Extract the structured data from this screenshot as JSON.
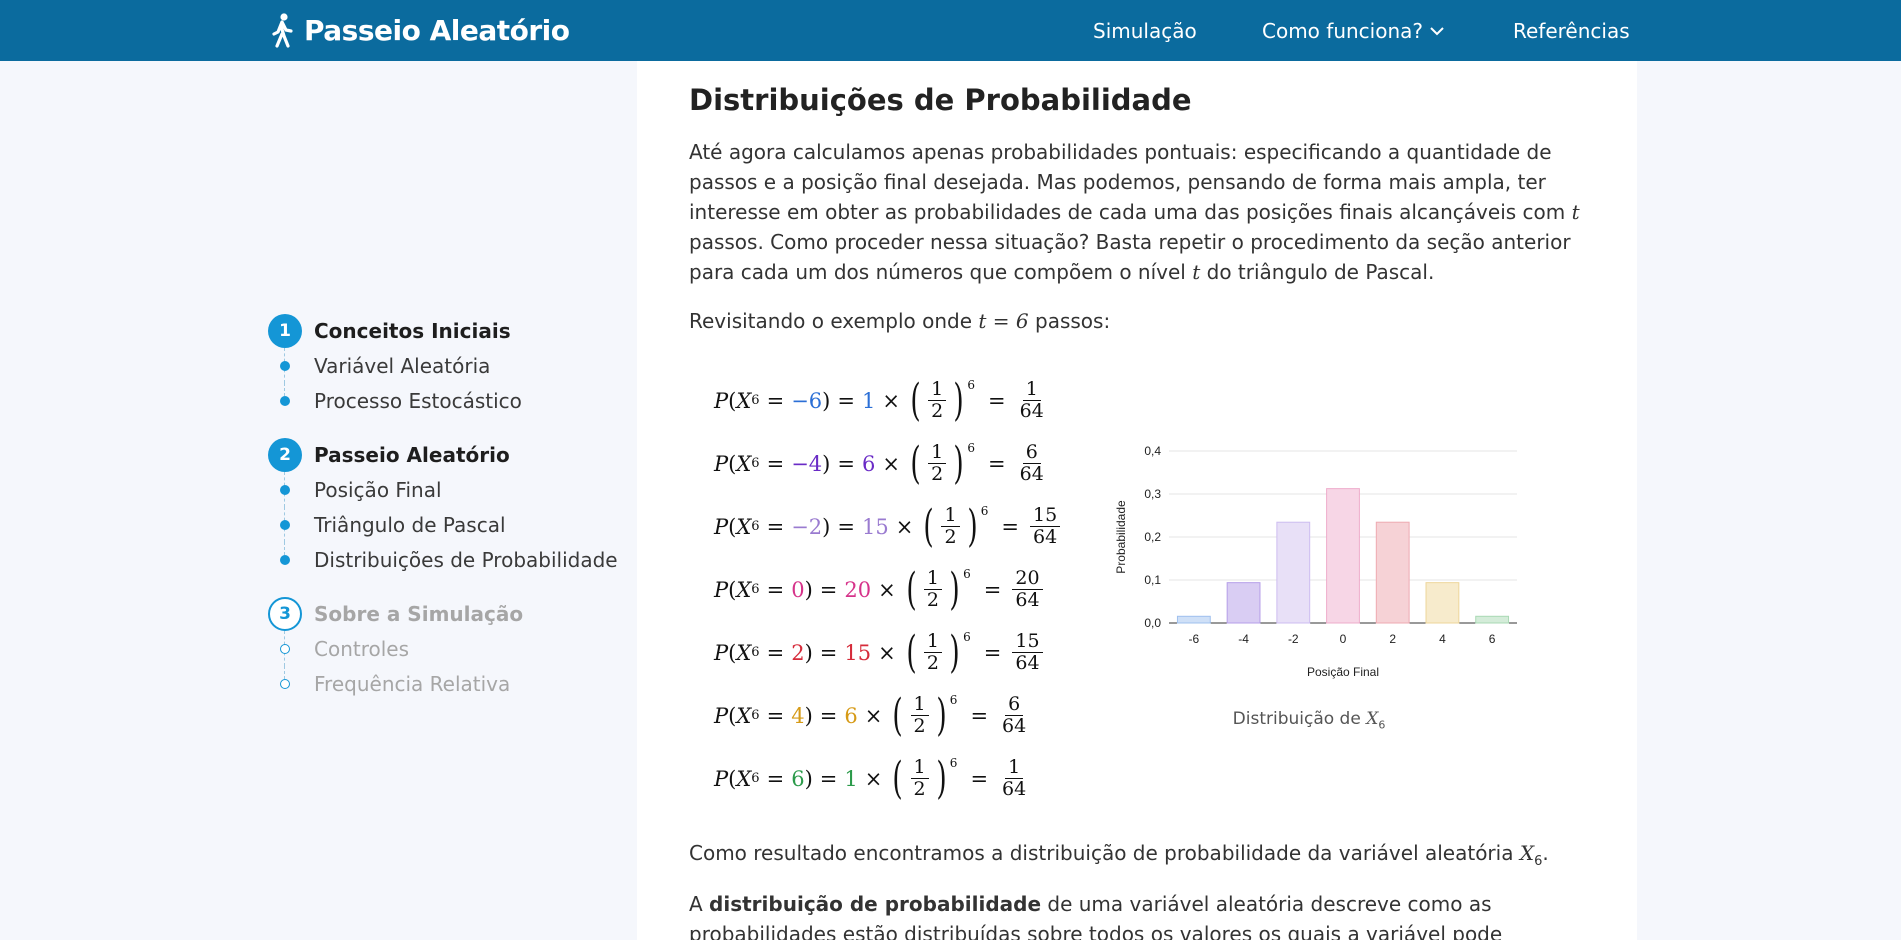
{
  "header": {
    "brand": "Passeio Aleatório",
    "nav": [
      {
        "label": "Simulação"
      },
      {
        "label": "Como funciona?"
      },
      {
        "label": "Referências"
      }
    ]
  },
  "sidebar": {
    "sections": [
      {
        "number": "1",
        "title": "Conceitos Iniciais",
        "items": [
          "Variável Aleatória",
          "Processo Estocástico"
        ]
      },
      {
        "number": "2",
        "title": "Passeio Aleatório",
        "items": [
          "Posição Final",
          "Triângulo de Pascal",
          "Distribuições de Probabilidade"
        ]
      },
      {
        "number": "3",
        "title": "Sobre a Simulação",
        "items": [
          "Controles",
          "Frequência Relativa"
        ]
      }
    ]
  },
  "main": {
    "title": "Distribuições de Probabilidade",
    "p1_a": "Até agora calculamos apenas probabilidades pontuais: especificando a quantidade de passos e a posição final desejada. Mas podemos, pensando de forma mais ampla, ter interesse em obter as probabilidades de cada uma das posições finais alcançáveis com ",
    "p1_t": "t",
    "p1_b": " passos. Como proceder nessa situação? Basta repetir o procedimento da seção anterior para cada um dos números que compõem o nível ",
    "p1_t2": "t",
    "p1_c": " do triângulo de Pascal.",
    "p2_a": "Revisitando o exemplo onde ",
    "p2_math": "t = 6",
    "p2_b": " passos:",
    "p3_a": "Como resultado encontramos a distribuição de probabilidade da variável aleatória ",
    "p3_var": "X",
    "p3_sub": "6",
    "p3_b": ".",
    "p4_a": "A ",
    "p4_bold": "distribuição de probabilidade",
    "p4_b": " de uma variável aleatória descreve como as probabilidades estão distribuídas sobre todos os valores os quais a variável pode assumir. No contexto de uma",
    "caption_a": "Distribuição de ",
    "caption_var": "X",
    "caption_sub": "6"
  },
  "equations": [
    {
      "pos": "−6",
      "coef": "1",
      "num": "1",
      "color": "#2b6fd6"
    },
    {
      "pos": "−4",
      "coef": "6",
      "num": "6",
      "color": "#6a2bc6"
    },
    {
      "pos": "−2",
      "coef": "15",
      "num": "15",
      "color": "#9a7bd0"
    },
    {
      "pos": "0",
      "coef": "20",
      "num": "20",
      "color": "#d6338a"
    },
    {
      "pos": "2",
      "coef": "15",
      "num": "15",
      "color": "#d62b3a"
    },
    {
      "pos": "4",
      "coef": "6",
      "num": "6",
      "color": "#d69a16"
    },
    {
      "pos": "6",
      "coef": "1",
      "num": "1",
      "color": "#2b9a4a"
    }
  ],
  "eq_const": {
    "P": "P",
    "X": "X",
    "sub": "6",
    "half_n": "1",
    "half_d": "2",
    "power": "6",
    "den": "64"
  },
  "chart_data": {
    "type": "bar",
    "categories": [
      "-6",
      "-4",
      "-2",
      "0",
      "2",
      "4",
      "6"
    ],
    "values": [
      0.0156,
      0.0938,
      0.2344,
      0.3125,
      0.2344,
      0.0938,
      0.0156
    ],
    "bar_colors": [
      "#cfe0f7",
      "#d9cdf3",
      "#e8e0f7",
      "#f7d6e6",
      "#f6d2d6",
      "#f7ebcc",
      "#d4ecd9"
    ],
    "bar_borders": [
      "#9fc0ee",
      "#b59ee8",
      "#cdbdf0",
      "#eeaccb",
      "#eeaab2",
      "#eed69a",
      "#a9d9b4"
    ],
    "xlabel": "Posição Final",
    "ylabel": "Probabilidade",
    "yticks": [
      "0,0",
      "0,1",
      "0,2",
      "0,3",
      "0,4"
    ],
    "ylim": [
      0,
      0.4
    ]
  }
}
